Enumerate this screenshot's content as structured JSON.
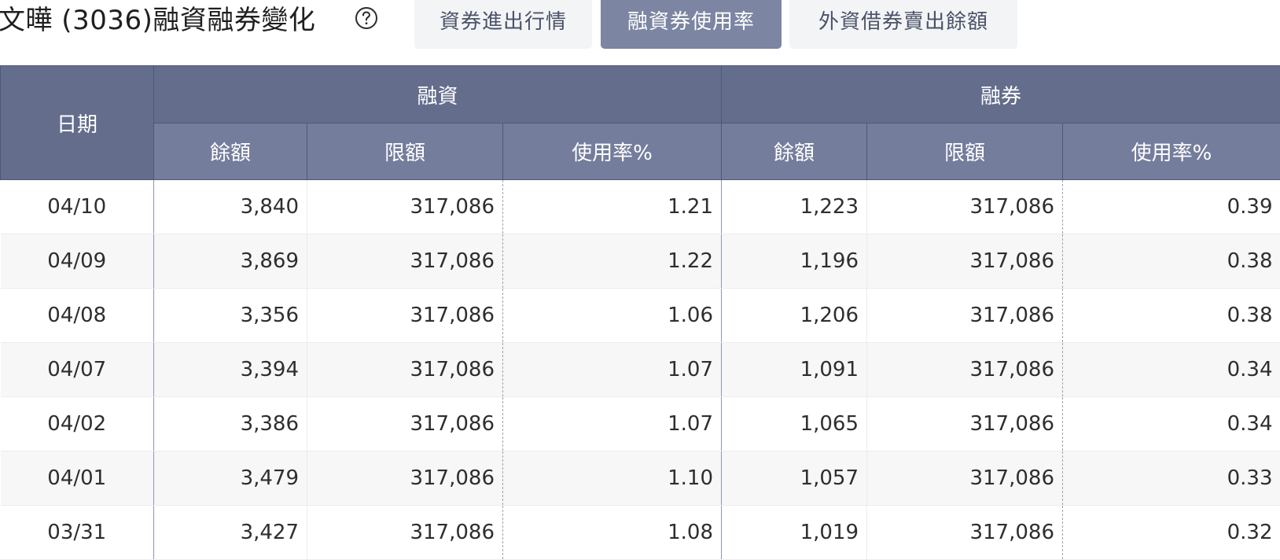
{
  "header": {
    "title": "文曄 (3036)融資融券變化",
    "help_icon": "question-circle-icon",
    "tabs": [
      {
        "label": "資券進出行情",
        "active": false
      },
      {
        "label": "融資券使用率",
        "active": true
      },
      {
        "label": "外資借券賣出餘額",
        "active": false
      }
    ]
  },
  "colors": {
    "header_dark": "#646d8c",
    "header_light": "#747d9c",
    "active_tab": "#7c85a2",
    "inactive_tab": "#f3f4f6",
    "row_alt": "#f7f7f7"
  },
  "table": {
    "date_header": "日期",
    "margin_group": "融資",
    "short_group": "融券",
    "sub_headers": [
      "餘額",
      "限額",
      "使用率%",
      "餘額",
      "限額",
      "使用率%"
    ],
    "rows": [
      [
        "04/10",
        "3,840",
        "317,086",
        "1.21",
        "1,223",
        "317,086",
        "0.39"
      ],
      [
        "04/09",
        "3,869",
        "317,086",
        "1.22",
        "1,196",
        "317,086",
        "0.38"
      ],
      [
        "04/08",
        "3,356",
        "317,086",
        "1.06",
        "1,206",
        "317,086",
        "0.38"
      ],
      [
        "04/07",
        "3,394",
        "317,086",
        "1.07",
        "1,091",
        "317,086",
        "0.34"
      ],
      [
        "04/02",
        "3,386",
        "317,086",
        "1.07",
        "1,065",
        "317,086",
        "0.34"
      ],
      [
        "04/01",
        "3,479",
        "317,086",
        "1.10",
        "1,057",
        "317,086",
        "0.33"
      ],
      [
        "03/31",
        "3,427",
        "317,086",
        "1.08",
        "1,019",
        "317,086",
        "0.32"
      ]
    ]
  }
}
